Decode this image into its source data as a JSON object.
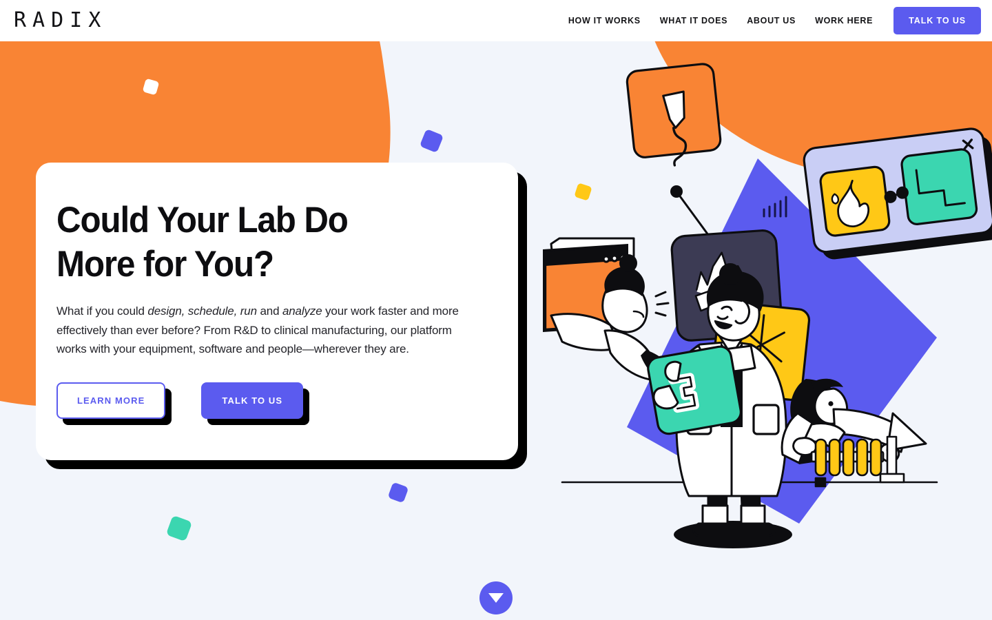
{
  "header": {
    "logo": "RADIX",
    "nav_items": [
      {
        "label": "HOW IT WORKS",
        "name": "nav-how-it-works"
      },
      {
        "label": "WHAT IT DOES",
        "name": "nav-what-it-does"
      },
      {
        "label": "ABOUT US",
        "name": "nav-about-us"
      },
      {
        "label": "WORK HERE",
        "name": "nav-work-here"
      }
    ],
    "cta_label": "TALK TO US"
  },
  "hero": {
    "title_line1": "Could Your Lab Do",
    "title_line2": "More for You?",
    "body_parts": {
      "p1": "What if you could ",
      "em1": "design, schedule, run",
      "p2": " and ",
      "em2": "analyze",
      "p3": " your work faster and more effectively than ever before? From R&D to clinical manufacturing, our platform works with your equipment, software and people—wherever they are."
    },
    "primary_button": "TALK TO US",
    "secondary_button": "LEARN MORE"
  },
  "scroll": {
    "icon": "chevron-down-icon",
    "label": "Scroll down"
  },
  "illustration": {
    "alt": "Lab automation illustration with scientists, connected task cards and test tubes",
    "cards": [
      {
        "name": "pipette-card",
        "color": "#F98434",
        "icon": "pipette-icon"
      },
      {
        "name": "bar-chart-card",
        "color": "#3C3B54",
        "icon": "bar-chart-icon"
      },
      {
        "name": "flame-card",
        "color": "#FFC816",
        "icon": "flame-icon"
      },
      {
        "name": "path-card",
        "color": "#3BD6B0",
        "icon": "step-path-icon"
      },
      {
        "name": "sparkle-card",
        "color": "#FFC816",
        "icon": "sparkle-icon"
      },
      {
        "name": "wave-card",
        "color": "#3BD6B0",
        "icon": "wave-bracket-icon"
      }
    ],
    "panel": {
      "name": "workflow-panel",
      "color": "#C9CEF5",
      "close_icon": "close-icon"
    },
    "browser_window": {
      "name": "browser-window",
      "color": "#F98434",
      "dots": 3
    },
    "test_tubes": {
      "name": "test-tube-rack",
      "count": 5,
      "color": "#FFC816"
    }
  },
  "colors": {
    "orange": "#F98434",
    "purple": "#5B5BEF",
    "teal": "#3BD6B0",
    "yellow": "#FFC816",
    "navy": "#3C3B54",
    "lavender": "#C9CEF5",
    "background": "#F2F5FB",
    "ink": "#0D0D10"
  }
}
